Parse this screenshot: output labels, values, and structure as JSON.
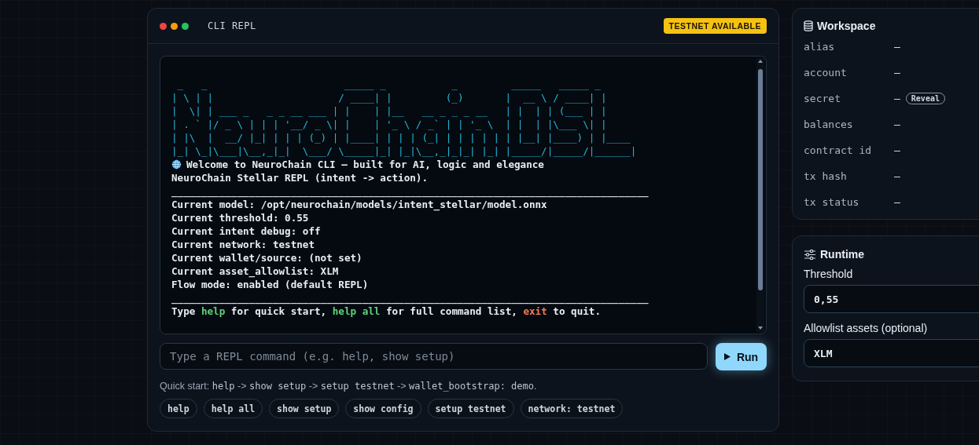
{
  "repl": {
    "dots": [
      {
        "color": "#ef4444"
      },
      {
        "color": "#f59e0b"
      },
      {
        "color": "#22c55e"
      }
    ],
    "title": "CLI REPL",
    "badge": "TESTNET AVAILABLE",
    "banner": [
      " _   _                       _____ _           _         _____   _____ _      ",
      "| \\ | |                     / ____| |         (_)       |  __ \\ / ____| |     ",
      "|  \\| | ___ _   _ _ __ ___ | |    | |__   __ _ _ _ __   | |  | | (___ | |     ",
      "| . ` |/ _ \\ | | | '__/ _ \\| |    | '_ \\ / _` | | '_ \\  | |  | |\\___ \\| |     ",
      "| |\\  |  __/ |_| | | | (_) | |____| | | | (_| | | | | | | |__| |____) | |____ ",
      "|_| \\_|\\___|\\__,_|_|  \\___/ \\_____|_| |_|\\__,_|_|_| |_| |_____/|_____/|______|"
    ],
    "output": [
      {
        "kind": "welcome",
        "parts": [
          {
            "kind": "text",
            "text": "Welcome to NeuroChain CLI — built for AI, logic and elegance"
          }
        ]
      },
      {
        "kind": "line",
        "parts": [
          {
            "kind": "text",
            "text": "NeuroChain Stellar REPL (intent -> action)."
          }
        ]
      },
      {
        "kind": "rule",
        "parts": [
          {
            "kind": "text",
            "text": "________________________________________________________________________________"
          }
        ]
      },
      {
        "kind": "line",
        "parts": [
          {
            "kind": "text",
            "text": "Current model: /opt/neurochain/models/intent_stellar/model.onnx"
          }
        ]
      },
      {
        "kind": "line",
        "parts": [
          {
            "kind": "text",
            "text": "Current threshold: 0.55"
          }
        ]
      },
      {
        "kind": "line",
        "parts": [
          {
            "kind": "text",
            "text": "Current intent debug: off"
          }
        ]
      },
      {
        "kind": "line",
        "parts": [
          {
            "kind": "text",
            "text": "Current network: testnet"
          }
        ]
      },
      {
        "kind": "line",
        "parts": [
          {
            "kind": "text",
            "text": "Current wallet/source: (not set)"
          }
        ]
      },
      {
        "kind": "line",
        "parts": [
          {
            "kind": "text",
            "text": "Current asset_allowlist: XLM"
          }
        ]
      },
      {
        "kind": "line",
        "parts": [
          {
            "kind": "text",
            "text": "Flow mode: enabled (default REPL)"
          }
        ]
      },
      {
        "kind": "rule",
        "parts": [
          {
            "kind": "text",
            "text": "________________________________________________________________________________"
          }
        ]
      },
      {
        "kind": "line",
        "parts": [
          {
            "kind": "text",
            "text": "Type "
          },
          {
            "kind": "command",
            "text": "help"
          },
          {
            "kind": "text",
            "text": " for quick start, "
          },
          {
            "kind": "command",
            "text": "help all"
          },
          {
            "kind": "text",
            "text": " for full command list, "
          },
          {
            "kind": "exit",
            "text": "exit"
          },
          {
            "kind": "text",
            "text": " to quit."
          }
        ]
      }
    ],
    "input": {
      "placeholder": "Type a REPL command (e.g. help, show setup)"
    },
    "run_button": "Run",
    "quick_start": [
      {
        "kind": "label",
        "text": "Quick start: "
      },
      {
        "kind": "code",
        "text": "help"
      },
      {
        "kind": "label",
        "text": " -> "
      },
      {
        "kind": "code",
        "text": "show setup"
      },
      {
        "kind": "label",
        "text": " -> "
      },
      {
        "kind": "code",
        "text": "setup testnet"
      },
      {
        "kind": "label",
        "text": " -> "
      },
      {
        "kind": "code",
        "text": "wallet_bootstrap: demo"
      },
      {
        "kind": "label",
        "text": "."
      }
    ],
    "chips": [
      "help",
      "help all",
      "show setup",
      "show config",
      "setup testnet",
      "network: testnet"
    ]
  },
  "workspace": {
    "title": "Workspace",
    "rows": [
      {
        "label": "alias",
        "value": "—"
      },
      {
        "label": "account",
        "value": "—"
      },
      {
        "label": "secret",
        "value": "—",
        "action": "Reveal"
      },
      {
        "label": "balances",
        "value": "—"
      },
      {
        "label": "contract id",
        "value": "—"
      },
      {
        "label": "tx hash",
        "value": "—"
      },
      {
        "label": "tx status",
        "value": "—"
      }
    ]
  },
  "runtime": {
    "title": "Runtime",
    "fields": [
      {
        "label": "Threshold",
        "value": "0,55"
      },
      {
        "label": "Allowlist assets (optional)",
        "value": "XLM"
      }
    ]
  }
}
